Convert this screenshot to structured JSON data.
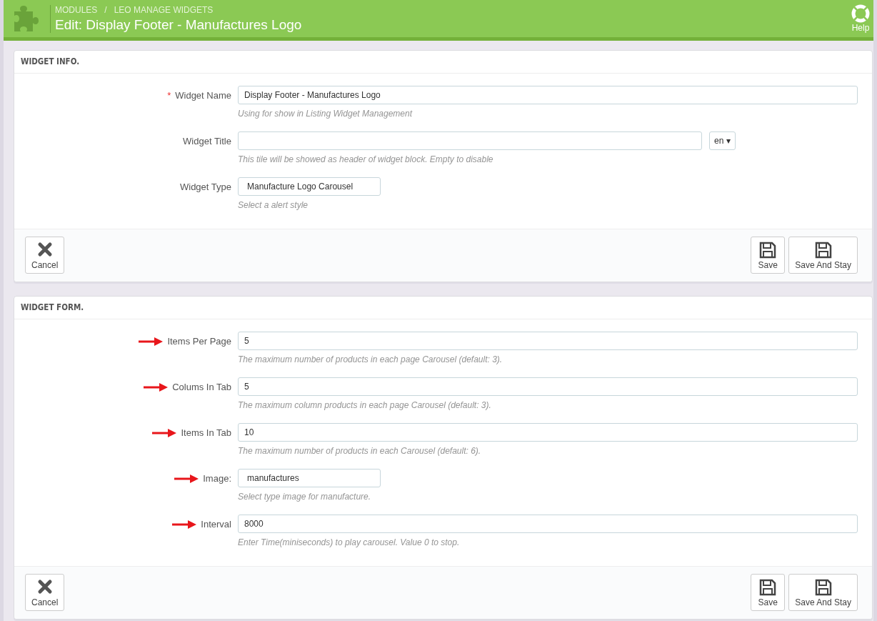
{
  "header": {
    "breadcrumb": [
      "MODULES",
      "LEO MANAGE WIDGETS"
    ],
    "separator": "/",
    "title": "Edit: Display Footer - Manufactures Logo",
    "help": "Help"
  },
  "panels": [
    {
      "heading": "WIDGET INFO.",
      "fields": [
        {
          "kind": "text",
          "label": "Widget Name",
          "required_mark": "*",
          "annotated": false,
          "value": "Display Footer - Manufactures Logo",
          "help": "Using for show in Listing Widget Management"
        },
        {
          "kind": "lang",
          "label": "Widget Title",
          "annotated": false,
          "lang": "en ▾",
          "help": "This tile will be showed as header of widget block. Empty to disable"
        },
        {
          "kind": "short",
          "label": "Widget Type",
          "annotated": false,
          "value": "Manufacture Logo Carousel",
          "help": "Select a alert style"
        }
      ],
      "footer": {
        "left": [
          {
            "kind": "cancel",
            "label": "Cancel"
          }
        ],
        "right": [
          {
            "kind": "save",
            "label": "Save"
          },
          {
            "kind": "save",
            "label": "Save And Stay"
          }
        ]
      }
    },
    {
      "heading": "WIDGET FORM.",
      "fields": [
        {
          "kind": "text",
          "label": "Items Per Page",
          "annotated": true,
          "value": "5",
          "help": "The maximum number of products in each page Carousel (default: 3)."
        },
        {
          "kind": "text",
          "label": "Colums In Tab",
          "annotated": true,
          "value": "5",
          "help": "The maximum column products in each page Carousel (default: 3)."
        },
        {
          "kind": "text",
          "label": "Items In Tab",
          "annotated": true,
          "value": "10",
          "help": "The maximum number of products in each Carousel (default: 6)."
        },
        {
          "kind": "short",
          "label": "Image:",
          "annotated": true,
          "value": "manufactures",
          "help": "Select type image for manufacture."
        },
        {
          "kind": "text",
          "label": "Interval",
          "annotated": true,
          "value": "8000",
          "help": "Enter Time(miniseconds) to play carousel. Value 0 to stop."
        }
      ],
      "footer": {
        "left": [
          {
            "kind": "cancel",
            "label": "Cancel"
          }
        ],
        "right": [
          {
            "kind": "save",
            "label": "Save"
          },
          {
            "kind": "save",
            "label": "Save And Stay"
          }
        ]
      }
    }
  ]
}
